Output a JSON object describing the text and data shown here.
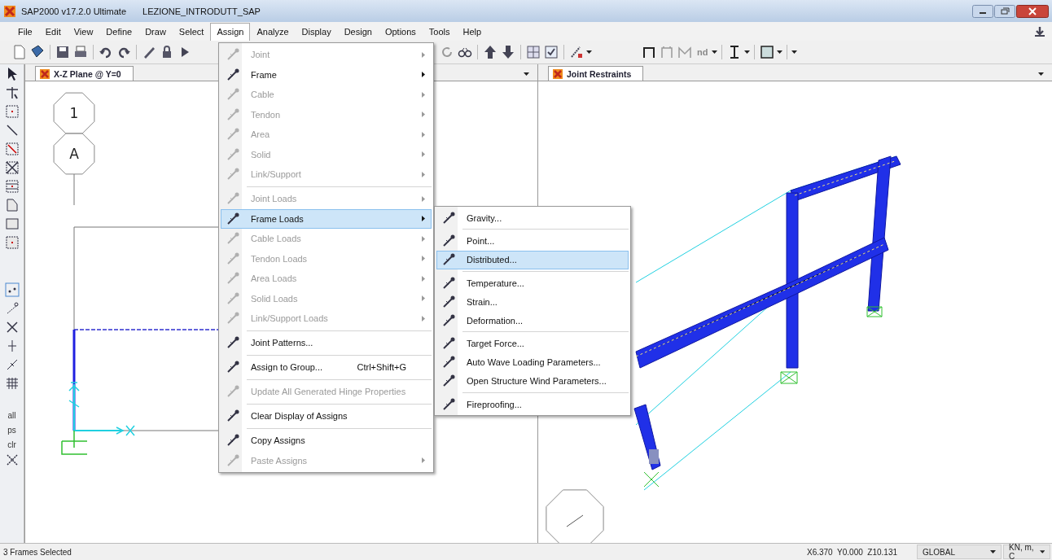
{
  "window": {
    "title": "SAP2000 v17.2.0 Ultimate",
    "document": "LEZIONE_INTRODUTT_SAP"
  },
  "menu_bar": [
    {
      "label": "File",
      "selected": false
    },
    {
      "label": "Edit",
      "selected": false
    },
    {
      "label": "View",
      "selected": false
    },
    {
      "label": "Define",
      "selected": false
    },
    {
      "label": "Draw",
      "selected": false
    },
    {
      "label": "Select",
      "selected": false
    },
    {
      "label": "Assign",
      "selected": true
    },
    {
      "label": "Analyze",
      "selected": false
    },
    {
      "label": "Display",
      "selected": false
    },
    {
      "label": "Design",
      "selected": false
    },
    {
      "label": "Options",
      "selected": false
    },
    {
      "label": "Tools",
      "selected": false
    },
    {
      "label": "Help",
      "selected": false
    }
  ],
  "toolbar": {
    "text_button": "nd"
  },
  "side_toolbar": {
    "select_buttons": [
      "all",
      "ps",
      "clr"
    ]
  },
  "views": [
    {
      "tab": "X-Z Plane @ Y=0",
      "grid_bubbles": [
        "1",
        "A"
      ]
    },
    {
      "tab": "Joint Restraints"
    }
  ],
  "assign_menu": [
    {
      "kind": "submenu",
      "label": "Joint",
      "disabled": true,
      "selected": false
    },
    {
      "kind": "submenu",
      "label": "Frame",
      "disabled": false,
      "selected": false
    },
    {
      "kind": "submenu",
      "label": "Cable",
      "disabled": true,
      "selected": false
    },
    {
      "kind": "submenu",
      "label": "Tendon",
      "disabled": true,
      "selected": false
    },
    {
      "kind": "submenu",
      "label": "Area",
      "disabled": true,
      "selected": false
    },
    {
      "kind": "submenu",
      "label": "Solid",
      "disabled": true,
      "selected": false
    },
    {
      "kind": "submenu",
      "label": "Link/Support",
      "disabled": true,
      "selected": false
    },
    {
      "kind": "separator"
    },
    {
      "kind": "submenu",
      "label": "Joint Loads",
      "disabled": true,
      "selected": false
    },
    {
      "kind": "submenu",
      "label": "Frame Loads",
      "disabled": false,
      "selected": true
    },
    {
      "kind": "submenu",
      "label": "Cable Loads",
      "disabled": true,
      "selected": false
    },
    {
      "kind": "submenu",
      "label": "Tendon Loads",
      "disabled": true,
      "selected": false
    },
    {
      "kind": "submenu",
      "label": "Area Loads",
      "disabled": true,
      "selected": false
    },
    {
      "kind": "submenu",
      "label": "Solid Loads",
      "disabled": true,
      "selected": false
    },
    {
      "kind": "submenu",
      "label": "Link/Support Loads",
      "disabled": true,
      "selected": false
    },
    {
      "kind": "separator"
    },
    {
      "kind": "item",
      "label": "Joint Patterns...",
      "disabled": false,
      "selected": false
    },
    {
      "kind": "separator"
    },
    {
      "kind": "item",
      "label": "Assign to Group...",
      "shortcut": "Ctrl+Shift+G",
      "disabled": false,
      "selected": false
    },
    {
      "kind": "separator"
    },
    {
      "kind": "item",
      "label": "Update All Generated Hinge Properties",
      "disabled": true,
      "selected": false
    },
    {
      "kind": "separator"
    },
    {
      "kind": "item",
      "label": "Clear Display of Assigns",
      "disabled": false,
      "selected": false
    },
    {
      "kind": "separator"
    },
    {
      "kind": "item",
      "label": "Copy Assigns",
      "disabled": false,
      "selected": false
    },
    {
      "kind": "submenu",
      "label": "Paste Assigns",
      "disabled": true,
      "selected": false
    }
  ],
  "frame_loads_submenu": [
    {
      "kind": "item",
      "label": "Gravity...",
      "disabled": false,
      "selected": false
    },
    {
      "kind": "separator"
    },
    {
      "kind": "item",
      "label": "Point...",
      "disabled": false,
      "selected": false
    },
    {
      "kind": "item",
      "label": "Distributed...",
      "disabled": false,
      "selected": true
    },
    {
      "kind": "separator"
    },
    {
      "kind": "item",
      "label": "Temperature...",
      "disabled": false,
      "selected": false
    },
    {
      "kind": "item",
      "label": "Strain...",
      "disabled": false,
      "selected": false
    },
    {
      "kind": "item",
      "label": "Deformation...",
      "disabled": false,
      "selected": false
    },
    {
      "kind": "separator"
    },
    {
      "kind": "item",
      "label": "Target Force...",
      "disabled": false,
      "selected": false
    },
    {
      "kind": "item",
      "label": "Auto Wave Loading Parameters...",
      "disabled": false,
      "selected": false
    },
    {
      "kind": "item",
      "label": "Open Structure Wind Parameters...",
      "disabled": false,
      "selected": false
    },
    {
      "kind": "separator"
    },
    {
      "kind": "item",
      "label": "Fireproofing...",
      "disabled": false,
      "selected": false
    }
  ],
  "status_bar": {
    "message": "3 Frames Selected",
    "coordinates": "X6.370  Y0.000  Z10.131",
    "coordinate_system": "GLOBAL",
    "units": "KN, m, C"
  }
}
